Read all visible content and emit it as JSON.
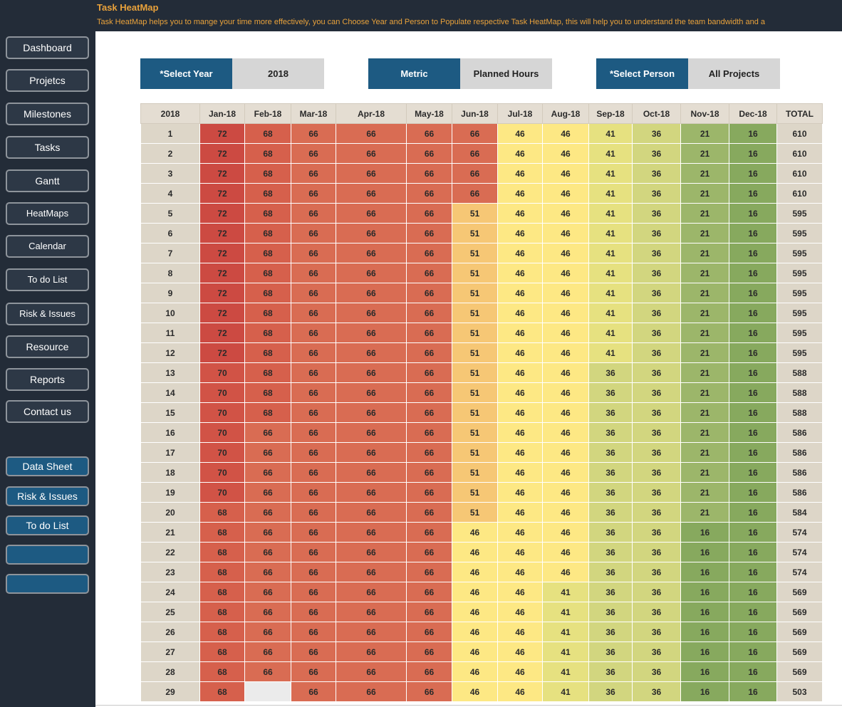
{
  "header": {
    "title": "Task HeatMap",
    "description": "Task HeatMap helps you to mange your time more effectively, you can Choose Year and Person to Populate respective Task HeatMap, this will help you to understand the team bandwidth and a"
  },
  "nav": {
    "dashboard": "Dashboard",
    "projects": "Projetcs",
    "milestones": "Milestones",
    "tasks": "Tasks",
    "gantt": "Gantt",
    "heatmaps": "HeatMaps",
    "calendar": "Calendar",
    "todo": "To do List",
    "risk": "Risk & Issues",
    "resource": "Resource",
    "reports": "Reports",
    "contact": "Contact us",
    "data_sheet": "Data Sheet",
    "risk2": "Risk & Issues",
    "todo2": "To do List",
    "blank1": "",
    "blank2": ""
  },
  "selectors": {
    "year_label": "*Select Year",
    "year_value": "2018",
    "metric_label": "Metric",
    "metric_value": "Planned Hours",
    "person_label": "*Select Person",
    "person_value": "All Projects"
  },
  "colors": {
    "sidebar_bg": "#232c38",
    "accent_blue": "#1d5a82",
    "title_orange": "#e9a23b"
  },
  "heatmap": {
    "year_header": "2018",
    "months": [
      "Jan-18",
      "Feb-18",
      "Mar-18",
      "Apr-18",
      "May-18",
      "Jun-18",
      "Jul-18",
      "Aug-18",
      "Sep-18",
      "Oct-18",
      "Nov-18",
      "Dec-18"
    ],
    "total_header": "TOTAL",
    "rows": [
      {
        "day": "1",
        "values": [
          72,
          68,
          66,
          66,
          66,
          66,
          46,
          46,
          41,
          36,
          21,
          16
        ],
        "total": "610"
      },
      {
        "day": "2",
        "values": [
          72,
          68,
          66,
          66,
          66,
          66,
          46,
          46,
          41,
          36,
          21,
          16
        ],
        "total": "610"
      },
      {
        "day": "3",
        "values": [
          72,
          68,
          66,
          66,
          66,
          66,
          46,
          46,
          41,
          36,
          21,
          16
        ],
        "total": "610"
      },
      {
        "day": "4",
        "values": [
          72,
          68,
          66,
          66,
          66,
          66,
          46,
          46,
          41,
          36,
          21,
          16
        ],
        "total": "610"
      },
      {
        "day": "5",
        "values": [
          72,
          68,
          66,
          66,
          66,
          51,
          46,
          46,
          41,
          36,
          21,
          16
        ],
        "total": "595"
      },
      {
        "day": "6",
        "values": [
          72,
          68,
          66,
          66,
          66,
          51,
          46,
          46,
          41,
          36,
          21,
          16
        ],
        "total": "595"
      },
      {
        "day": "7",
        "values": [
          72,
          68,
          66,
          66,
          66,
          51,
          46,
          46,
          41,
          36,
          21,
          16
        ],
        "total": "595"
      },
      {
        "day": "8",
        "values": [
          72,
          68,
          66,
          66,
          66,
          51,
          46,
          46,
          41,
          36,
          21,
          16
        ],
        "total": "595"
      },
      {
        "day": "9",
        "values": [
          72,
          68,
          66,
          66,
          66,
          51,
          46,
          46,
          41,
          36,
          21,
          16
        ],
        "total": "595"
      },
      {
        "day": "10",
        "values": [
          72,
          68,
          66,
          66,
          66,
          51,
          46,
          46,
          41,
          36,
          21,
          16
        ],
        "total": "595"
      },
      {
        "day": "11",
        "values": [
          72,
          68,
          66,
          66,
          66,
          51,
          46,
          46,
          41,
          36,
          21,
          16
        ],
        "total": "595"
      },
      {
        "day": "12",
        "values": [
          72,
          68,
          66,
          66,
          66,
          51,
          46,
          46,
          41,
          36,
          21,
          16
        ],
        "total": "595"
      },
      {
        "day": "13",
        "values": [
          70,
          68,
          66,
          66,
          66,
          51,
          46,
          46,
          36,
          36,
          21,
          16
        ],
        "total": "588"
      },
      {
        "day": "14",
        "values": [
          70,
          68,
          66,
          66,
          66,
          51,
          46,
          46,
          36,
          36,
          21,
          16
        ],
        "total": "588"
      },
      {
        "day": "15",
        "values": [
          70,
          68,
          66,
          66,
          66,
          51,
          46,
          46,
          36,
          36,
          21,
          16
        ],
        "total": "588"
      },
      {
        "day": "16",
        "values": [
          70,
          66,
          66,
          66,
          66,
          51,
          46,
          46,
          36,
          36,
          21,
          16
        ],
        "total": "586"
      },
      {
        "day": "17",
        "values": [
          70,
          66,
          66,
          66,
          66,
          51,
          46,
          46,
          36,
          36,
          21,
          16
        ],
        "total": "586"
      },
      {
        "day": "18",
        "values": [
          70,
          66,
          66,
          66,
          66,
          51,
          46,
          46,
          36,
          36,
          21,
          16
        ],
        "total": "586"
      },
      {
        "day": "19",
        "values": [
          70,
          66,
          66,
          66,
          66,
          51,
          46,
          46,
          36,
          36,
          21,
          16
        ],
        "total": "586"
      },
      {
        "day": "20",
        "values": [
          68,
          66,
          66,
          66,
          66,
          51,
          46,
          46,
          36,
          36,
          21,
          16
        ],
        "total": "584"
      },
      {
        "day": "21",
        "values": [
          68,
          66,
          66,
          66,
          66,
          46,
          46,
          46,
          36,
          36,
          16,
          16
        ],
        "total": "574"
      },
      {
        "day": "22",
        "values": [
          68,
          66,
          66,
          66,
          66,
          46,
          46,
          46,
          36,
          36,
          16,
          16
        ],
        "total": "574"
      },
      {
        "day": "23",
        "values": [
          68,
          66,
          66,
          66,
          66,
          46,
          46,
          46,
          36,
          36,
          16,
          16
        ],
        "total": "574"
      },
      {
        "day": "24",
        "values": [
          68,
          66,
          66,
          66,
          66,
          46,
          46,
          41,
          36,
          36,
          16,
          16
        ],
        "total": "569"
      },
      {
        "day": "25",
        "values": [
          68,
          66,
          66,
          66,
          66,
          46,
          46,
          41,
          36,
          36,
          16,
          16
        ],
        "total": "569"
      },
      {
        "day": "26",
        "values": [
          68,
          66,
          66,
          66,
          66,
          46,
          46,
          41,
          36,
          36,
          16,
          16
        ],
        "total": "569"
      },
      {
        "day": "27",
        "values": [
          68,
          66,
          66,
          66,
          66,
          46,
          46,
          41,
          36,
          36,
          16,
          16
        ],
        "total": "569"
      },
      {
        "day": "28",
        "values": [
          68,
          66,
          66,
          66,
          66,
          46,
          46,
          41,
          36,
          36,
          16,
          16
        ],
        "total": "569"
      },
      {
        "day": "29",
        "values": [
          68,
          null,
          66,
          66,
          66,
          46,
          46,
          41,
          36,
          36,
          16,
          16
        ],
        "total": "503"
      }
    ]
  }
}
